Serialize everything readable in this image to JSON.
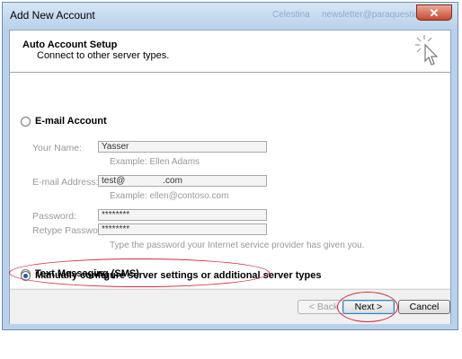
{
  "window": {
    "title": "Add New Account",
    "close_label": "✕",
    "ghost_texts": [
      "Celestina",
      "newsletter@paraquestion"
    ]
  },
  "header": {
    "title": "Auto Account Setup",
    "subtitle": "Connect to other server types."
  },
  "options": {
    "email_account": {
      "label": "E-mail Account",
      "selected": false
    },
    "text_messaging": {
      "label": "Text Messaging (SMS)",
      "selected": false
    },
    "manual": {
      "label": "Manually configure server settings or additional server types",
      "selected": true
    }
  },
  "fields": {
    "your_name": {
      "label": "Your Name:",
      "value": "Yasser",
      "hint": "Example: Ellen Adams"
    },
    "email": {
      "label": "E-mail Address:",
      "value_prefix": "test@",
      "value_suffix": ".com",
      "hint": "Example: ellen@contoso.com"
    },
    "password": {
      "label": "Password:",
      "value": "********"
    },
    "retype_password": {
      "label": "Retype Password:",
      "value": "********",
      "hint": "Type the password your Internet service provider has given you."
    }
  },
  "buttons": {
    "back": "< Back",
    "next": "Next >",
    "cancel": "Cancel"
  },
  "annotation_color": "#d22a3a"
}
